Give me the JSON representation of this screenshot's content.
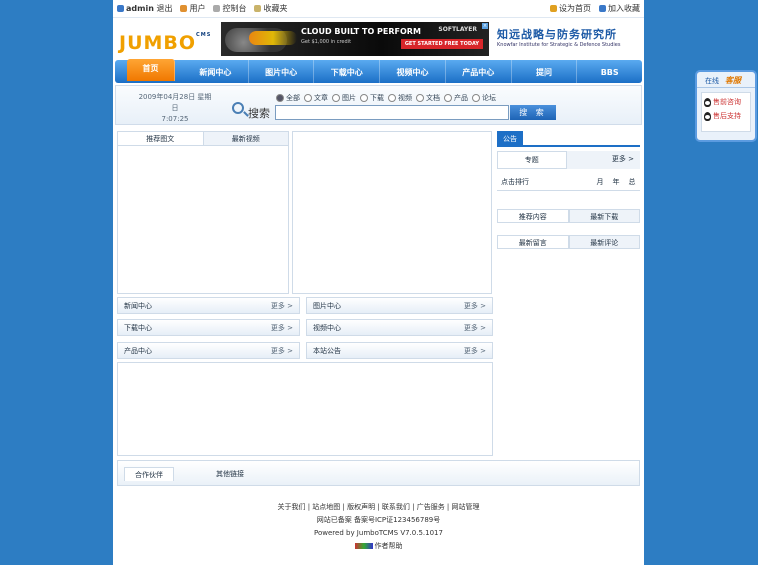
{
  "topbar": {
    "user": "admin",
    "logout": "退出",
    "items": [
      "用户",
      "控制台",
      "收藏夹"
    ],
    "right": [
      "设为首页",
      "加入收藏"
    ]
  },
  "logo": {
    "text": "JUMBO",
    "sub": "CMS"
  },
  "ad": {
    "title": "CLOUD BUILT TO PERFORM",
    "sub": "Get $1,000 in credit",
    "logo": "SOFTLAYER",
    "button": "GET STARTED FREE TODAY"
  },
  "slogan": {
    "cn": "知远战略与防务研究所",
    "en": "Knowfar Institute for Strategic & Defence Studies"
  },
  "nav": {
    "home": "首页",
    "items": [
      "新闻中心",
      "图片中心",
      "下载中心",
      "视频中心",
      "产品中心",
      "提问",
      "BBS"
    ]
  },
  "search": {
    "date": "2009年04月28日 星期日",
    "time": "7:07:25",
    "label": "搜索",
    "options": [
      "全部",
      "文章",
      "图片",
      "下载",
      "视频",
      "文档",
      "产品",
      "论坛"
    ],
    "button": "搜 索",
    "placeholder": ""
  },
  "left": {
    "tabs": [
      "推荐图文",
      "最新视频"
    ],
    "modules": [
      {
        "title": "新闻中心",
        "more": "更多 >"
      },
      {
        "title": "图片中心",
        "more": "更多 >"
      },
      {
        "title": "下载中心",
        "more": "更多 >"
      },
      {
        "title": "视频中心",
        "more": "更多 >"
      },
      {
        "title": "产品中心",
        "more": "更多 >"
      },
      {
        "title": "本站公告",
        "more": "更多 >"
      }
    ]
  },
  "right": {
    "ad_tag": "公告",
    "row1": {
      "a": "专题",
      "b": "更多 >"
    },
    "rank": {
      "label": "点击排行",
      "cols": [
        "月",
        "年",
        "总"
      ]
    },
    "tabs1": [
      "推荐内容",
      "最新下载"
    ],
    "tabs2": [
      "最新留言",
      "最新评论"
    ]
  },
  "coop": {
    "tabs": [
      "合作伙伴",
      "其他链接"
    ]
  },
  "footer": {
    "links": "关于我们 | 站点地图 | 版权声明 | 联系我们 | 广告服务 | 网站管理",
    "icp": "网站已备案 备案号ICP证123456789号",
    "powered": "Powered by JumboTCMS V7.0.5.1017",
    "badge": "作者帮助"
  },
  "side": {
    "a": "在线",
    "b": "客服",
    "items": [
      "售前咨询",
      "售后支持"
    ]
  }
}
